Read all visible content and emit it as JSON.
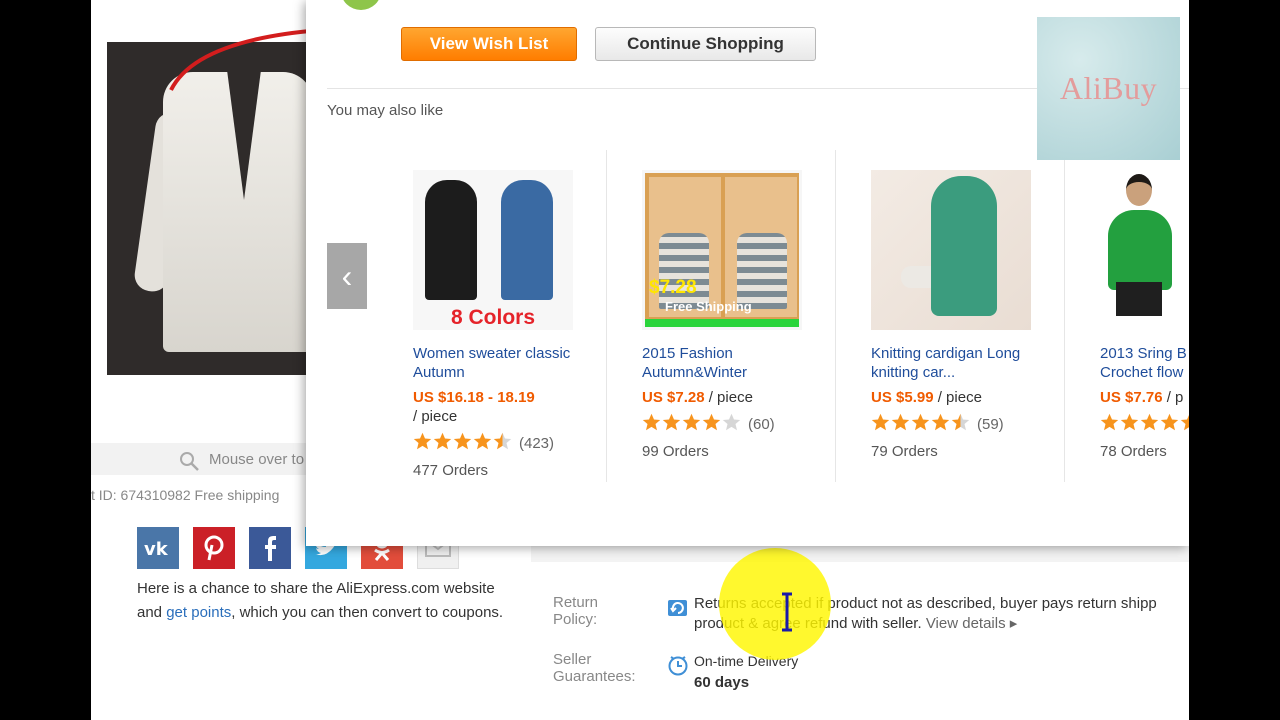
{
  "background": {
    "zoom_hint": "Mouse over to",
    "product_id_line": "t ID: 674310982 Free shipping",
    "share_text_before": "Here is a chance to share the AliExpress.com website and ",
    "share_link": "get points",
    "share_text_after": ", which you can then convert to coupons.",
    "share_icons": [
      "vk-icon",
      "pinterest-icon",
      "facebook-icon",
      "twitter-icon",
      "odnoklassniki-icon",
      "email-icon"
    ],
    "return_policy": {
      "label": "Return Policy:",
      "line1": "Returns accepted if product not as described, buyer pays return shipp",
      "line2": "product & agree refund with seller.",
      "view_details": "View details"
    },
    "seller_guarantees": {
      "label": "Seller Guarantees:",
      "name": "On-time Delivery",
      "days": "60 days"
    }
  },
  "modal": {
    "view_wish_list": "View Wish List",
    "continue_shopping": "Continue Shopping",
    "section_title": "You may also like",
    "prev_arrow": "‹",
    "products": [
      {
        "title": "Women sweater classic Autumn",
        "price": "US $16.18 - 18.19",
        "unit": "/ piece",
        "rating": 4.5,
        "reviews": "(423)",
        "orders": "477 Orders",
        "image_caption": "8 Colors"
      },
      {
        "title": "2015 Fashion Autumn&Winter",
        "price": "US $7.28",
        "unit": "/ piece",
        "rating": 4.0,
        "reviews": "(60)",
        "orders": "99 Orders",
        "image_price": "$7.28",
        "image_shipping": "Free Shipping"
      },
      {
        "title": "Knitting cardigan Long knitting car...",
        "price": "US $5.99",
        "unit": "/ piece",
        "rating": 4.5,
        "reviews": "(59)",
        "orders": "79 Orders"
      },
      {
        "title": "2013 Sring B Crochet flow",
        "price": "US $7.76",
        "unit": "/ p",
        "rating": 5.0,
        "reviews": "",
        "orders": "78 Orders"
      }
    ]
  },
  "logo_text": "AliBuy",
  "colors": {
    "accent_orange": "#ff8a00",
    "price_orange": "#f05b00",
    "link_blue": "#1f4d9b",
    "star_orange": "#f7941d",
    "highlight_yellow": "#fff600"
  }
}
